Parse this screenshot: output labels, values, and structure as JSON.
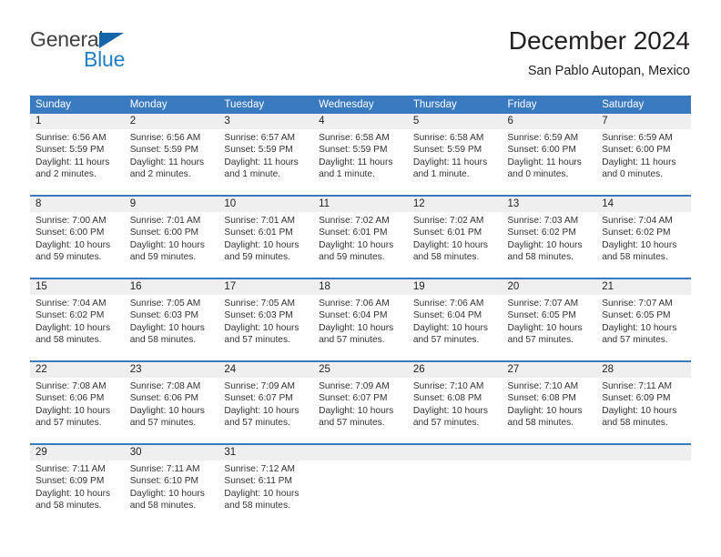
{
  "brand": {
    "name_top": "General",
    "name_bottom": "Blue",
    "triangle_color": "#1464aa",
    "blue_color": "#1f7fc4",
    "gray_color": "#414042"
  },
  "header": {
    "title": "December 2024",
    "subtitle": "San Pablo Autopan, Mexico"
  },
  "colors": {
    "header_band": "#3a7ac0",
    "date_band": "#efefef",
    "text": "#231f20",
    "cell_text": "#333333"
  },
  "weekdays": [
    "Sunday",
    "Monday",
    "Tuesday",
    "Wednesday",
    "Thursday",
    "Friday",
    "Saturday"
  ],
  "weeks": [
    [
      {
        "day": "1",
        "sunrise": "Sunrise: 6:56 AM",
        "sunset": "Sunset: 5:59 PM",
        "daylight1": "Daylight: 11 hours",
        "daylight2": "and 2 minutes."
      },
      {
        "day": "2",
        "sunrise": "Sunrise: 6:56 AM",
        "sunset": "Sunset: 5:59 PM",
        "daylight1": "Daylight: 11 hours",
        "daylight2": "and 2 minutes."
      },
      {
        "day": "3",
        "sunrise": "Sunrise: 6:57 AM",
        "sunset": "Sunset: 5:59 PM",
        "daylight1": "Daylight: 11 hours",
        "daylight2": "and 1 minute."
      },
      {
        "day": "4",
        "sunrise": "Sunrise: 6:58 AM",
        "sunset": "Sunset: 5:59 PM",
        "daylight1": "Daylight: 11 hours",
        "daylight2": "and 1 minute."
      },
      {
        "day": "5",
        "sunrise": "Sunrise: 6:58 AM",
        "sunset": "Sunset: 5:59 PM",
        "daylight1": "Daylight: 11 hours",
        "daylight2": "and 1 minute."
      },
      {
        "day": "6",
        "sunrise": "Sunrise: 6:59 AM",
        "sunset": "Sunset: 6:00 PM",
        "daylight1": "Daylight: 11 hours",
        "daylight2": "and 0 minutes."
      },
      {
        "day": "7",
        "sunrise": "Sunrise: 6:59 AM",
        "sunset": "Sunset: 6:00 PM",
        "daylight1": "Daylight: 11 hours",
        "daylight2": "and 0 minutes."
      }
    ],
    [
      {
        "day": "8",
        "sunrise": "Sunrise: 7:00 AM",
        "sunset": "Sunset: 6:00 PM",
        "daylight1": "Daylight: 10 hours",
        "daylight2": "and 59 minutes."
      },
      {
        "day": "9",
        "sunrise": "Sunrise: 7:01 AM",
        "sunset": "Sunset: 6:00 PM",
        "daylight1": "Daylight: 10 hours",
        "daylight2": "and 59 minutes."
      },
      {
        "day": "10",
        "sunrise": "Sunrise: 7:01 AM",
        "sunset": "Sunset: 6:01 PM",
        "daylight1": "Daylight: 10 hours",
        "daylight2": "and 59 minutes."
      },
      {
        "day": "11",
        "sunrise": "Sunrise: 7:02 AM",
        "sunset": "Sunset: 6:01 PM",
        "daylight1": "Daylight: 10 hours",
        "daylight2": "and 59 minutes."
      },
      {
        "day": "12",
        "sunrise": "Sunrise: 7:02 AM",
        "sunset": "Sunset: 6:01 PM",
        "daylight1": "Daylight: 10 hours",
        "daylight2": "and 58 minutes."
      },
      {
        "day": "13",
        "sunrise": "Sunrise: 7:03 AM",
        "sunset": "Sunset: 6:02 PM",
        "daylight1": "Daylight: 10 hours",
        "daylight2": "and 58 minutes."
      },
      {
        "day": "14",
        "sunrise": "Sunrise: 7:04 AM",
        "sunset": "Sunset: 6:02 PM",
        "daylight1": "Daylight: 10 hours",
        "daylight2": "and 58 minutes."
      }
    ],
    [
      {
        "day": "15",
        "sunrise": "Sunrise: 7:04 AM",
        "sunset": "Sunset: 6:02 PM",
        "daylight1": "Daylight: 10 hours",
        "daylight2": "and 58 minutes."
      },
      {
        "day": "16",
        "sunrise": "Sunrise: 7:05 AM",
        "sunset": "Sunset: 6:03 PM",
        "daylight1": "Daylight: 10 hours",
        "daylight2": "and 58 minutes."
      },
      {
        "day": "17",
        "sunrise": "Sunrise: 7:05 AM",
        "sunset": "Sunset: 6:03 PM",
        "daylight1": "Daylight: 10 hours",
        "daylight2": "and 57 minutes."
      },
      {
        "day": "18",
        "sunrise": "Sunrise: 7:06 AM",
        "sunset": "Sunset: 6:04 PM",
        "daylight1": "Daylight: 10 hours",
        "daylight2": "and 57 minutes."
      },
      {
        "day": "19",
        "sunrise": "Sunrise: 7:06 AM",
        "sunset": "Sunset: 6:04 PM",
        "daylight1": "Daylight: 10 hours",
        "daylight2": "and 57 minutes."
      },
      {
        "day": "20",
        "sunrise": "Sunrise: 7:07 AM",
        "sunset": "Sunset: 6:05 PM",
        "daylight1": "Daylight: 10 hours",
        "daylight2": "and 57 minutes."
      },
      {
        "day": "21",
        "sunrise": "Sunrise: 7:07 AM",
        "sunset": "Sunset: 6:05 PM",
        "daylight1": "Daylight: 10 hours",
        "daylight2": "and 57 minutes."
      }
    ],
    [
      {
        "day": "22",
        "sunrise": "Sunrise: 7:08 AM",
        "sunset": "Sunset: 6:06 PM",
        "daylight1": "Daylight: 10 hours",
        "daylight2": "and 57 minutes."
      },
      {
        "day": "23",
        "sunrise": "Sunrise: 7:08 AM",
        "sunset": "Sunset: 6:06 PM",
        "daylight1": "Daylight: 10 hours",
        "daylight2": "and 57 minutes."
      },
      {
        "day": "24",
        "sunrise": "Sunrise: 7:09 AM",
        "sunset": "Sunset: 6:07 PM",
        "daylight1": "Daylight: 10 hours",
        "daylight2": "and 57 minutes."
      },
      {
        "day": "25",
        "sunrise": "Sunrise: 7:09 AM",
        "sunset": "Sunset: 6:07 PM",
        "daylight1": "Daylight: 10 hours",
        "daylight2": "and 57 minutes."
      },
      {
        "day": "26",
        "sunrise": "Sunrise: 7:10 AM",
        "sunset": "Sunset: 6:08 PM",
        "daylight1": "Daylight: 10 hours",
        "daylight2": "and 57 minutes."
      },
      {
        "day": "27",
        "sunrise": "Sunrise: 7:10 AM",
        "sunset": "Sunset: 6:08 PM",
        "daylight1": "Daylight: 10 hours",
        "daylight2": "and 58 minutes."
      },
      {
        "day": "28",
        "sunrise": "Sunrise: 7:11 AM",
        "sunset": "Sunset: 6:09 PM",
        "daylight1": "Daylight: 10 hours",
        "daylight2": "and 58 minutes."
      }
    ],
    [
      {
        "day": "29",
        "sunrise": "Sunrise: 7:11 AM",
        "sunset": "Sunset: 6:09 PM",
        "daylight1": "Daylight: 10 hours",
        "daylight2": "and 58 minutes."
      },
      {
        "day": "30",
        "sunrise": "Sunrise: 7:11 AM",
        "sunset": "Sunset: 6:10 PM",
        "daylight1": "Daylight: 10 hours",
        "daylight2": "and 58 minutes."
      },
      {
        "day": "31",
        "sunrise": "Sunrise: 7:12 AM",
        "sunset": "Sunset: 6:11 PM",
        "daylight1": "Daylight: 10 hours",
        "daylight2": "and 58 minutes."
      },
      {
        "day": "",
        "sunrise": "",
        "sunset": "",
        "daylight1": "",
        "daylight2": ""
      },
      {
        "day": "",
        "sunrise": "",
        "sunset": "",
        "daylight1": "",
        "daylight2": ""
      },
      {
        "day": "",
        "sunrise": "",
        "sunset": "",
        "daylight1": "",
        "daylight2": ""
      },
      {
        "day": "",
        "sunrise": "",
        "sunset": "",
        "daylight1": "",
        "daylight2": ""
      }
    ]
  ]
}
